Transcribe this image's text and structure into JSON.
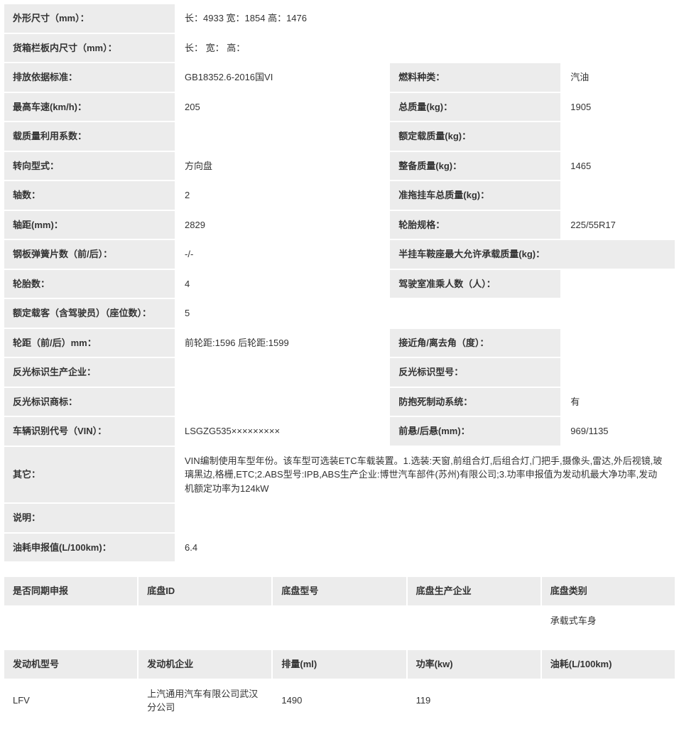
{
  "specs": {
    "dimensions_label": "外形尺寸（mm）：",
    "dimensions_value": "长：4933 宽：1854 高：1476",
    "cargo_dim_label": "货箱栏板内尺寸（mm）：",
    "cargo_dim_value": "长： 宽： 高：",
    "emission_label": "排放依据标准：",
    "emission_value": "GB18352.6-2016国VI",
    "fuel_label": "燃料种类：",
    "fuel_value": "汽油",
    "topspeed_label": "最高车速(km/h)：",
    "topspeed_value": "205",
    "totalmass_label": "总质量(kg)：",
    "totalmass_value": "1905",
    "loadcoef_label": "载质量利用系数：",
    "loadcoef_value": "",
    "ratedload_label": "额定载质量(kg)：",
    "ratedload_value": "",
    "steering_label": "转向型式：",
    "steering_value": "方向盘",
    "curbmass_label": "整备质量(kg)：",
    "curbmass_value": "1465",
    "axles_label": "轴数：",
    "axles_value": "2",
    "trailer_label": "准拖挂车总质量(kg)：",
    "trailer_value": "",
    "wheelbase_label": "轴距(mm)：",
    "wheelbase_value": "2829",
    "tirespec_label": "轮胎规格：",
    "tirespec_value": "225/55R17",
    "leafspring_label": "钢板弹簧片数（前/后）：",
    "leafspring_value": "-/-",
    "semitrailer_label": "半挂车鞍座最大允许承载质量(kg)：",
    "semitrailer_value": "",
    "tirecount_label": "轮胎数：",
    "tirecount_value": "4",
    "cabseats_label": "驾驶室准乘人数（人）：",
    "cabseats_value": "",
    "ratedpassenger_label": "额定载客（含驾驶员）（座位数）：",
    "ratedpassenger_value": "5",
    "track_label": "轮距（前/后）mm：",
    "track_value": "前轮距:1596 后轮距:1599",
    "approach_label": "接近角/离去角（度）：",
    "approach_value": "",
    "reflmfr_label": "反光标识生产企业：",
    "reflmfr_value": "",
    "reflmodel_label": "反光标识型号：",
    "reflmodel_value": "",
    "refltm_label": "反光标识商标：",
    "refltm_value": "",
    "abs_label": "防抱死制动系统：",
    "abs_value": "有",
    "vin_label": "车辆识别代号（VIN）：",
    "vin_value": "LSGZG535×××××××××",
    "overhang_label": "前悬/后悬(mm)：",
    "overhang_value": "969/1135",
    "other_label": "其它：",
    "other_value": "VIN编制使用车型年份。该车型可选装ETC车载装置。1.选装:天窗,前组合灯,后组合灯,门把手,摄像头,雷达,外后视镜,玻璃黑边,格栅,ETC;2.ABS型号:IPB,ABS生产企业:博世汽车部件(苏州)有限公司;3.功率申报值为发动机最大净功率,发动机额定功率为124kW",
    "note_label": "说明：",
    "note_value": "",
    "fuel100_label": "油耗申报值(L/100km)：",
    "fuel100_value": "6.4"
  },
  "chassis": {
    "h1": "是否同期申报",
    "h2": "底盘ID",
    "h3": "底盘型号",
    "h4": "底盘生产企业",
    "h5": "底盘类别",
    "v1": "",
    "v2": "",
    "v3": "",
    "v4": "",
    "v5": "承载式车身"
  },
  "engine": {
    "h1": "发动机型号",
    "h2": "发动机企业",
    "h3": "排量(ml)",
    "h4": "功率(kw)",
    "h5": "油耗(L/100km)",
    "v1": "LFV",
    "v2": "上汽通用汽车有限公司武汉分公司",
    "v3": "1490",
    "v4": "119",
    "v5": ""
  }
}
